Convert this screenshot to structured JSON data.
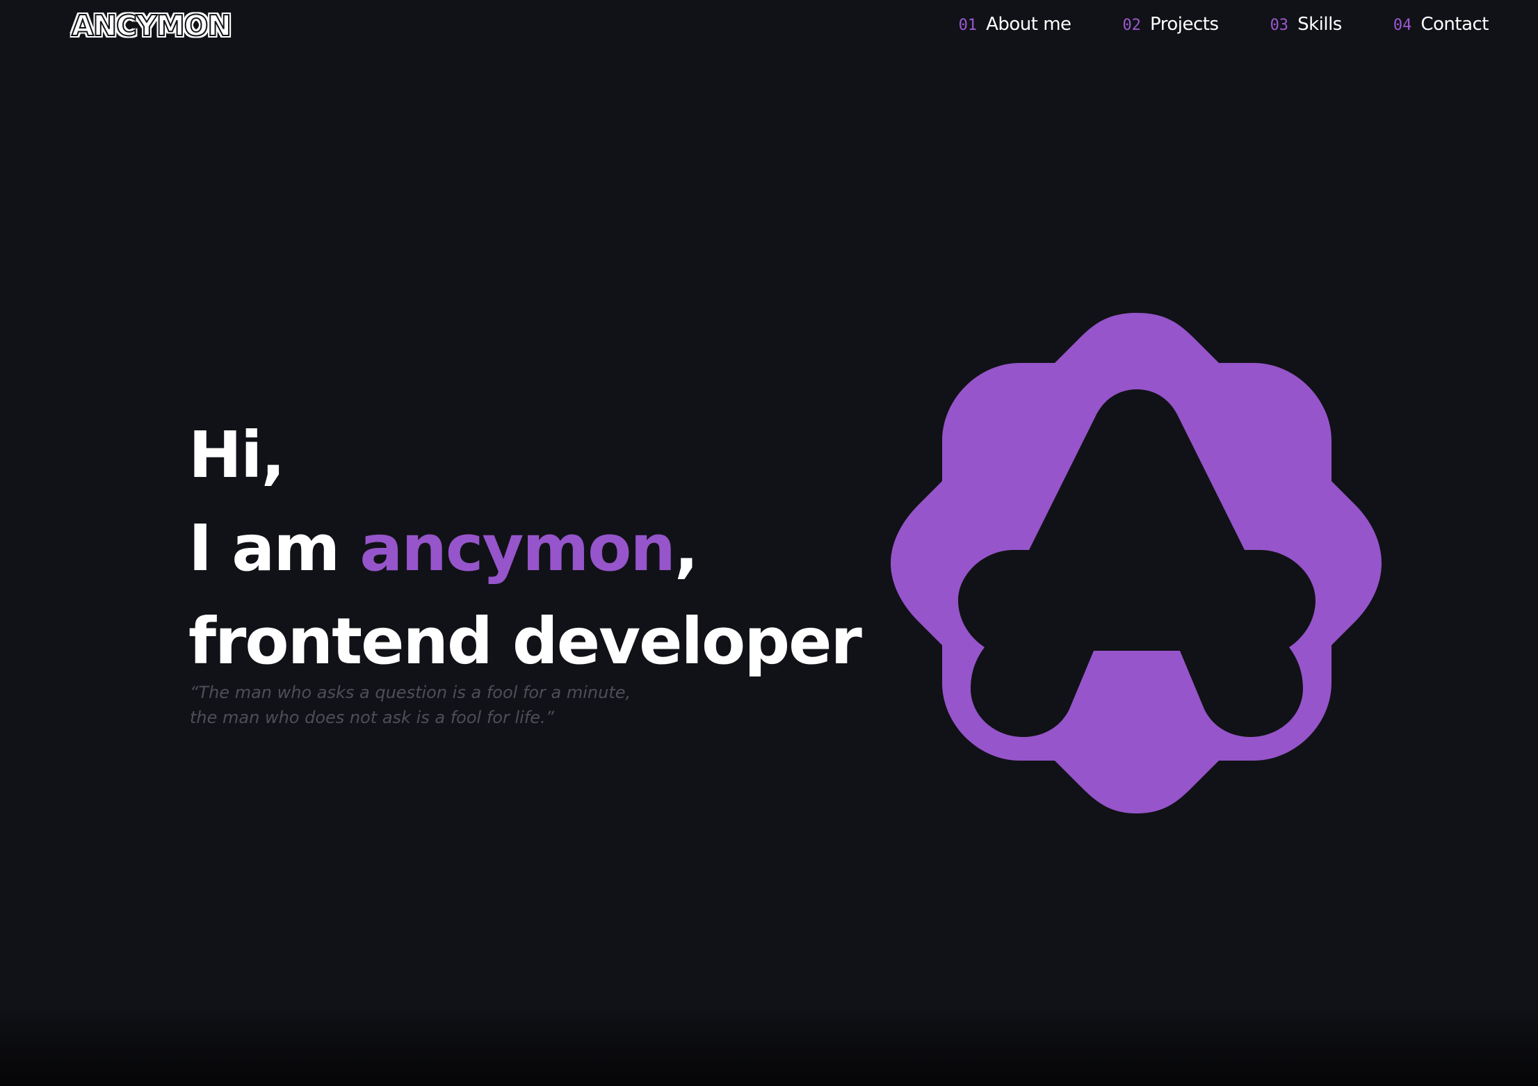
{
  "header": {
    "logo_text": "ANCYMON",
    "nav": [
      {
        "num": "01",
        "label": "About me"
      },
      {
        "num": "02",
        "label": "Projects"
      },
      {
        "num": "03",
        "label": "Skills"
      },
      {
        "num": "04",
        "label": "Contact"
      }
    ]
  },
  "hero": {
    "line1": "Hi,",
    "line2_prefix": "I am ",
    "line2_name": "ancymon",
    "line2_suffix": ",",
    "line3": "frontend developer",
    "quote_line1": "“The man who asks a question is a fool for a minute,",
    "quote_line2": "the man who does not ask is a fool for life.”"
  },
  "colors": {
    "background": "#111217",
    "accent": "#9655ca",
    "text": "#ffffff",
    "muted": "#4e4e58"
  },
  "icons": {
    "emblem": "ancymon-logo-icon"
  }
}
